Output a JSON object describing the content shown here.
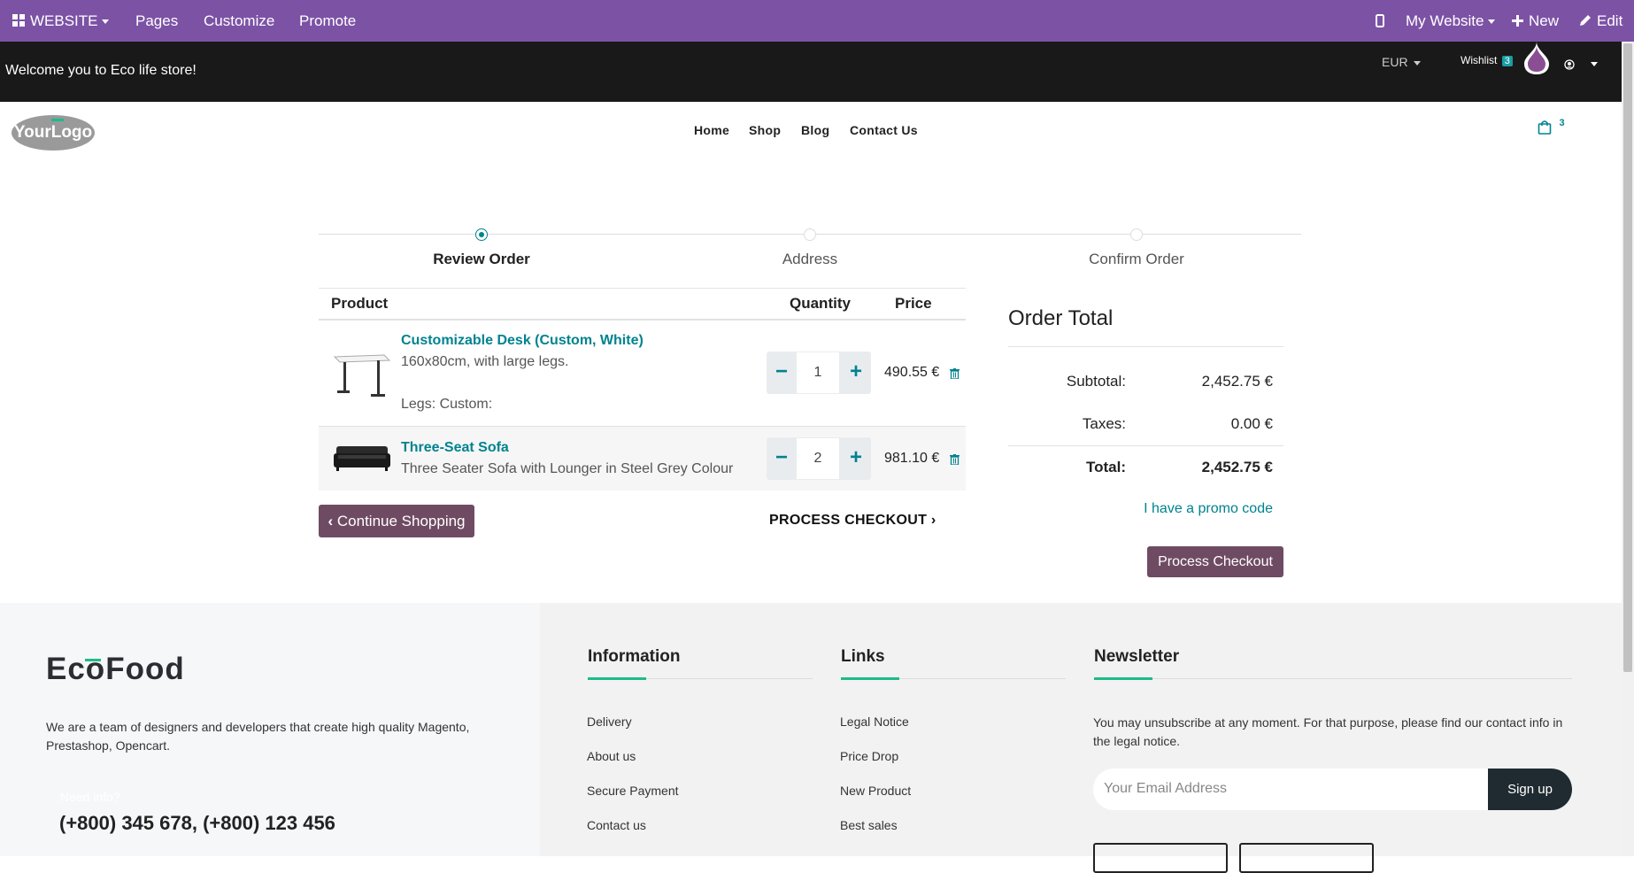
{
  "admin_bar": {
    "website_label": "WEBSITE",
    "pages": "Pages",
    "customize": "Customize",
    "promote": "Promote",
    "my_website": "My Website",
    "new": "New",
    "edit": "Edit"
  },
  "top_bar": {
    "welcome": "Welcome you to Eco life store!",
    "currency": "EUR",
    "wishlist_label": "Wishlist",
    "wishlist_count": "3"
  },
  "header": {
    "logo_text": "YourLogo",
    "nav": [
      "Home",
      "Shop",
      "Blog",
      "Contact Us"
    ],
    "cart_count": "3"
  },
  "progress": {
    "steps": [
      "Review Order",
      "Address",
      "Confirm Order"
    ],
    "active_step": 0
  },
  "cart": {
    "headers": {
      "product": "Product",
      "quantity": "Quantity",
      "price": "Price"
    },
    "items": [
      {
        "name": "Customizable Desk (Custom, White)",
        "description": "160x80cm, with large legs.",
        "extra": "Legs: Custom:",
        "qty": "1",
        "price": "490.55 €",
        "image": "desk-image"
      },
      {
        "name": "Three-Seat Sofa",
        "description": "Three Seater Sofa with Lounger in Steel Grey Colour",
        "qty": "2",
        "price": "981.10 €",
        "image": "sofa-image"
      }
    ],
    "continue_shopping": "Continue Shopping",
    "process_checkout_link": "PROCESS CHECKOUT"
  },
  "order_total": {
    "title": "Order Total",
    "subtotal_label": "Subtotal:",
    "subtotal": "2,452.75 €",
    "taxes_label": "Taxes:",
    "taxes": "0.00 €",
    "total_label": "Total:",
    "total": "2,452.75 €",
    "promo": "I have a promo code",
    "checkout_button": "Process Checkout"
  },
  "footer": {
    "brand": "EcoFood",
    "about": "We are a team of designers and developers that create high quality Magento, Prestashop, Opencart.",
    "need_info": "Need info?",
    "phone": "(+800) 345 678, (+800) 123 456",
    "information": {
      "title": "Information",
      "links": [
        "Delivery",
        "About us",
        "Secure Payment",
        "Contact us"
      ]
    },
    "links": {
      "title": "Links",
      "links": [
        "Legal Notice",
        "Price Drop",
        "New Product",
        "Best sales"
      ]
    },
    "newsletter": {
      "title": "Newsletter",
      "text": "You may unsubscribe at any moment. For that purpose, please find our contact info in the legal notice.",
      "placeholder": "Your Email Address",
      "button": "Sign up"
    }
  },
  "colors": {
    "admin_bar": "#7c52a5",
    "accent_teal": "#00838f",
    "button_purple": "#6f4b63",
    "footer_accent": "#1dbb8a"
  }
}
